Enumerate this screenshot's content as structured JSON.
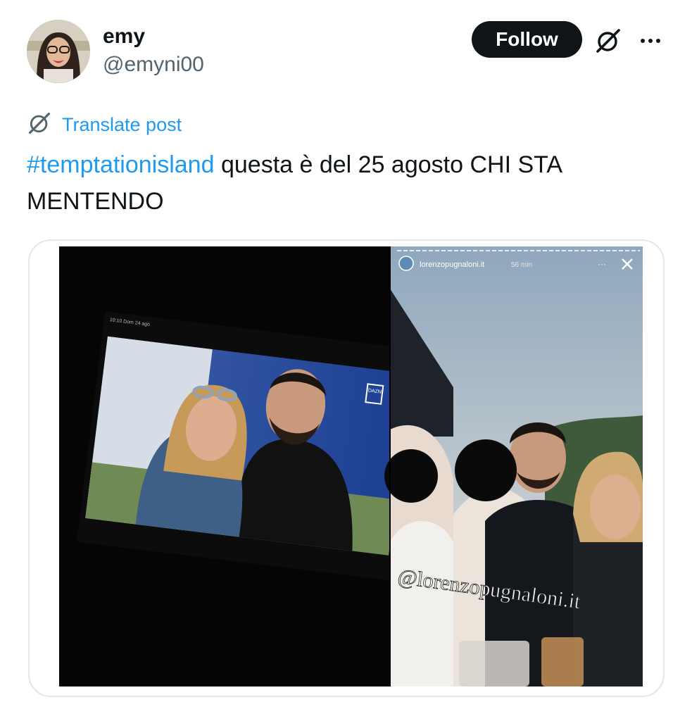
{
  "author": {
    "display_name": "emy",
    "handle": "@emyni00"
  },
  "actions": {
    "follow_label": "Follow",
    "grok_icon": "grok-icon",
    "more_icon": "more-icon"
  },
  "translate": {
    "icon": "grok-icon",
    "label": "Translate post"
  },
  "post": {
    "hashtag": "#temptationisland",
    "text": " questa è del 25 agosto CHI STA MENTENDO"
  },
  "media": {
    "left_panel": {
      "status_time": "10:10  Dom 24 ago",
      "tv_logo": "DAZN"
    },
    "right_panel": {
      "story_username": "lorenzopugnaloni.it",
      "story_time": "56 min",
      "watermark": "@lorenzopugnaloni.it"
    }
  },
  "colors": {
    "accent": "#1d9bf0",
    "text": "#0f1419",
    "secondary": "#536471",
    "button_bg": "#0f1419"
  }
}
